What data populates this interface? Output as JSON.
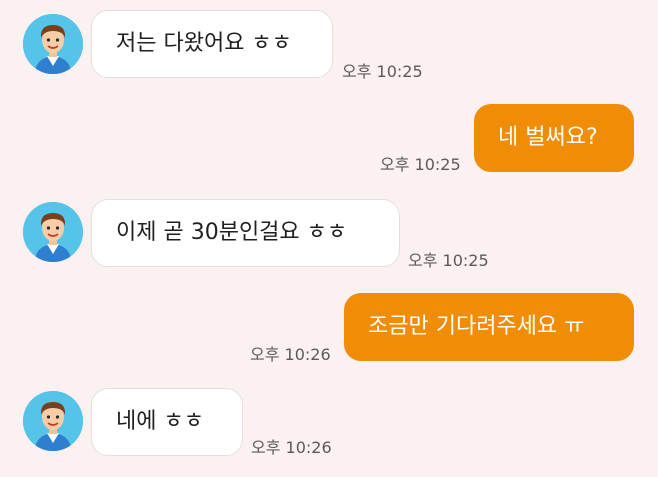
{
  "colors": {
    "background": "#fbf1f1",
    "incoming_bubble": "#ffffff",
    "outgoing_bubble": "#f08c06",
    "avatar_bg": "#56c4e8"
  },
  "messages": [
    {
      "direction": "in",
      "text": "저는 다왔어요 ㅎㅎ",
      "time": "오후 10:25",
      "avatar_icon": "user-avatar-icon"
    },
    {
      "direction": "out",
      "text": "네 벌써요?",
      "time": "오후 10:25"
    },
    {
      "direction": "in",
      "text": "이제 곧 30분인걸요 ㅎㅎ",
      "time": "오후 10:25",
      "avatar_icon": "user-avatar-icon"
    },
    {
      "direction": "out",
      "text": "조금만 기다려주세요 ㅠ",
      "time": "오후 10:26"
    },
    {
      "direction": "in",
      "text": "네에 ㅎㅎ",
      "time": "오후 10:26",
      "avatar_icon": "user-avatar-icon"
    }
  ]
}
